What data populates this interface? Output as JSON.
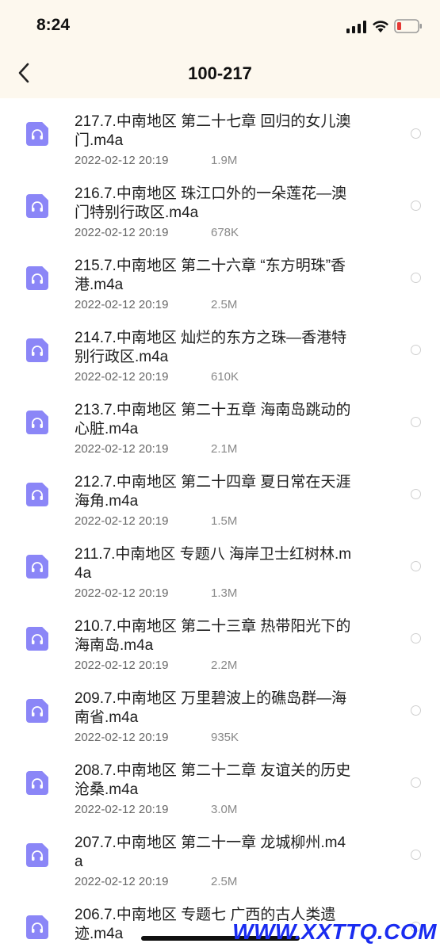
{
  "status_bar": {
    "time": "8:24",
    "battery_color": "#e53935"
  },
  "nav": {
    "back_icon": "chevron-left-icon",
    "title": "100-217"
  },
  "file_icon": "audio-file-icon",
  "accent_color": "#8b86f7",
  "files": [
    {
      "name": "217.7.中南地区 第二十七章 回归的女儿澳门.m4a",
      "date": "2022-02-12 20:19",
      "size": "1.9M"
    },
    {
      "name": "216.7.中南地区 珠江口外的一朵莲花—澳门特别行政区.m4a",
      "date": "2022-02-12 20:19",
      "size": "678K"
    },
    {
      "name": "215.7.中南地区 第二十六章 “东方明珠”香港.m4a",
      "date": "2022-02-12 20:19",
      "size": "2.5M"
    },
    {
      "name": "214.7.中南地区 灿烂的东方之珠—香港特别行政区.m4a",
      "date": "2022-02-12 20:19",
      "size": "610K"
    },
    {
      "name": "213.7.中南地区 第二十五章 海南岛跳动的心脏.m4a",
      "date": "2022-02-12 20:19",
      "size": "2.1M"
    },
    {
      "name": "212.7.中南地区 第二十四章 夏日常在天涯海角.m4a",
      "date": "2022-02-12 20:19",
      "size": "1.5M"
    },
    {
      "name": "211.7.中南地区 专题八 海岸卫士红树林.m4a",
      "date": "2022-02-12 20:19",
      "size": "1.3M"
    },
    {
      "name": "210.7.中南地区 第二十三章 热带阳光下的海南岛.m4a",
      "date": "2022-02-12 20:19",
      "size": "2.2M"
    },
    {
      "name": "209.7.中南地区 万里碧波上的礁岛群—海南省.m4a",
      "date": "2022-02-12 20:19",
      "size": "935K"
    },
    {
      "name": "208.7.中南地区 第二十二章 友谊关的历史沧桑.m4a",
      "date": "2022-02-12 20:19",
      "size": "3.0M"
    },
    {
      "name": "207.7.中南地区 第二十一章 龙城柳州.m4a",
      "date": "2022-02-12 20:19",
      "size": "2.5M"
    },
    {
      "name": "206.7.中南地区 专题七 广西的古人类遗迹.m4a",
      "date": "",
      "size": ""
    }
  ],
  "watermark": "WWW.XXTTQ.COM"
}
